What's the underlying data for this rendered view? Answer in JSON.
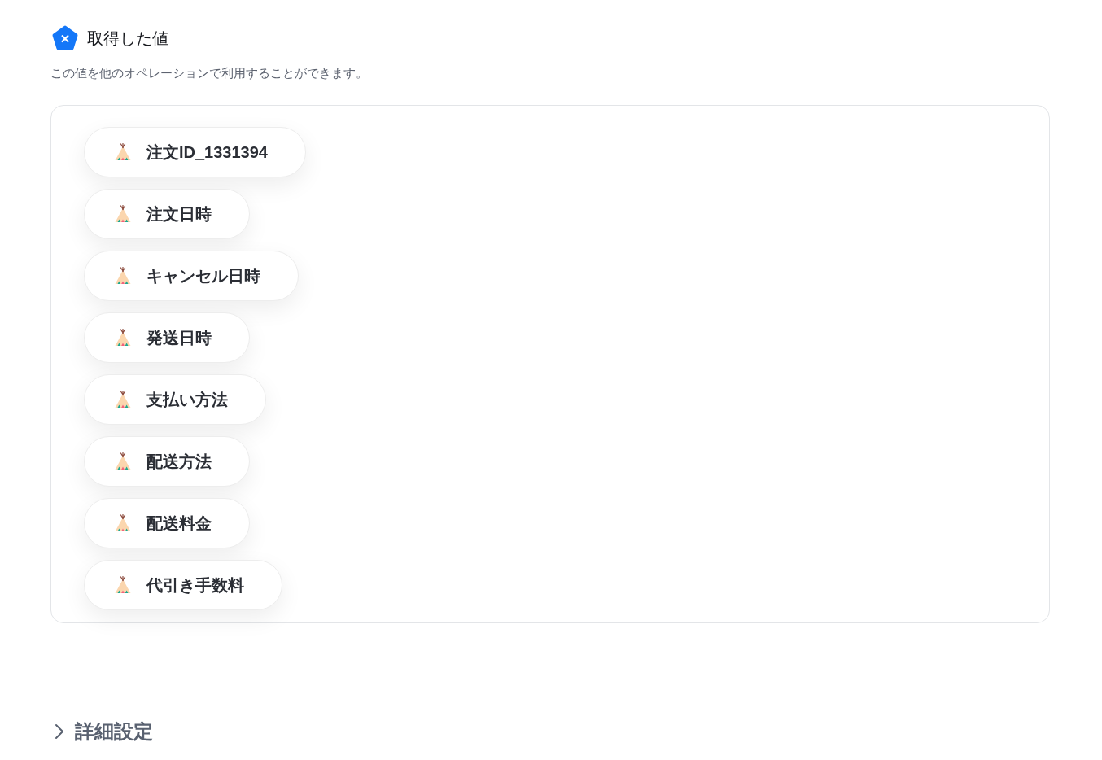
{
  "header": {
    "title": "取得した値",
    "description": "この値を他のオペレーションで利用することができます。"
  },
  "values": [
    {
      "label": "注文ID_1331394"
    },
    {
      "label": "注文日時"
    },
    {
      "label": "キャンセル日時"
    },
    {
      "label": "発送日時"
    },
    {
      "label": "支払い方法"
    },
    {
      "label": "配送方法"
    },
    {
      "label": "配送料金"
    },
    {
      "label": "代引き手数料"
    }
  ],
  "advanced": {
    "label": "詳細設定",
    "expanded": false
  }
}
